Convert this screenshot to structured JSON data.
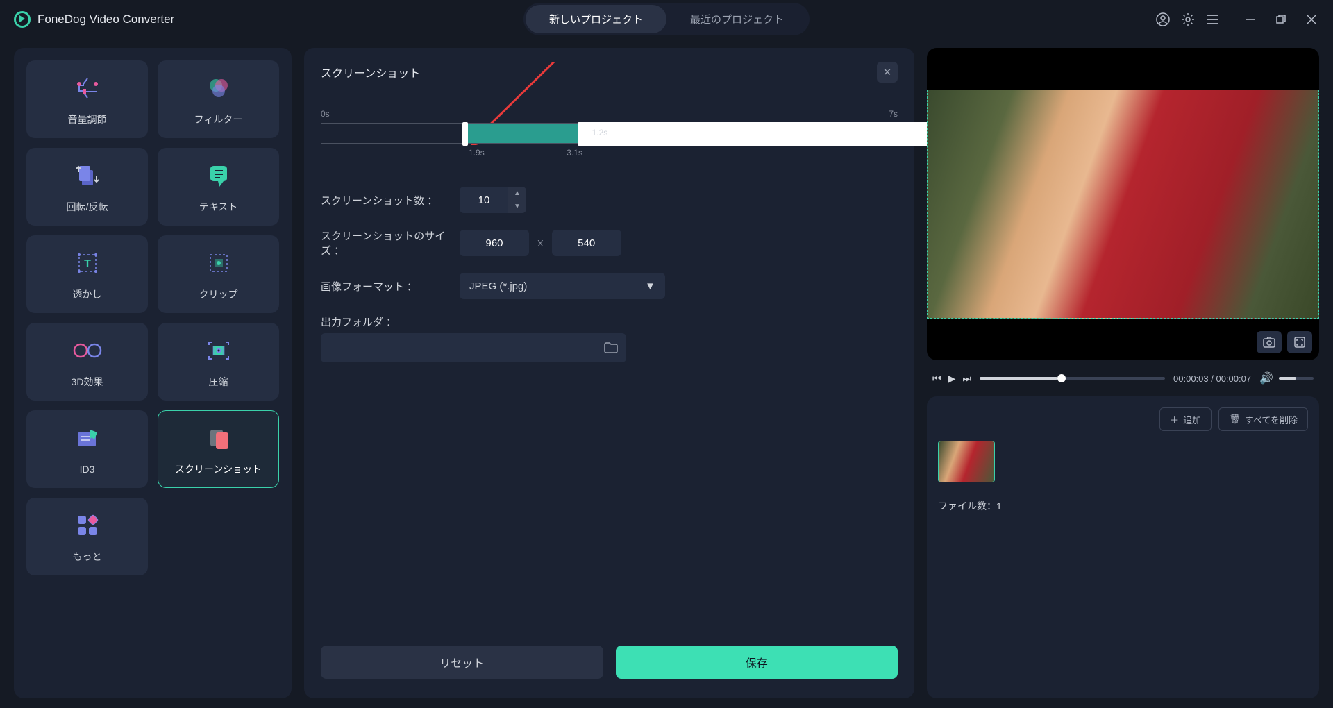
{
  "app": {
    "name": "FoneDog Video Converter"
  },
  "header": {
    "tab_new": "新しいプロジェクト",
    "tab_recent": "最近のプロジェクト"
  },
  "sidebar": {
    "tools": [
      {
        "id": "volume",
        "label": "音量調節"
      },
      {
        "id": "filter",
        "label": "フィルター"
      },
      {
        "id": "rotate",
        "label": "回転/反転"
      },
      {
        "id": "text",
        "label": "テキスト"
      },
      {
        "id": "watermark",
        "label": "透かし"
      },
      {
        "id": "clip",
        "label": "クリップ"
      },
      {
        "id": "3d",
        "label": "3D効果"
      },
      {
        "id": "compress",
        "label": "圧縮"
      },
      {
        "id": "id3",
        "label": "ID3"
      },
      {
        "id": "screenshot",
        "label": "スクリーンショット",
        "active": true
      },
      {
        "id": "more",
        "label": "もっと"
      }
    ]
  },
  "panel": {
    "title": "スクリーンショット",
    "timeline": {
      "start": "0s",
      "end": "7s",
      "sel_start": "1.9s",
      "sel_end": "3.1s",
      "duration": "1.2s"
    },
    "count_label": "スクリーンショット数",
    "count_value": "10",
    "size_label": "スクリーンショットのサイズ",
    "size_w": "960",
    "size_h": "540",
    "format_label": "画像フォーマット",
    "format_value": "JPEG (*.jpg)",
    "folder_label": "出力フォルダ",
    "reset": "リセット",
    "save": "保存"
  },
  "preview": {
    "time_current": "00:00:03",
    "time_total": "00:00:07"
  },
  "filelist": {
    "add": "追加",
    "delete_all": "すべてを削除",
    "count_label": "ファイル数：",
    "count_value": "1"
  }
}
